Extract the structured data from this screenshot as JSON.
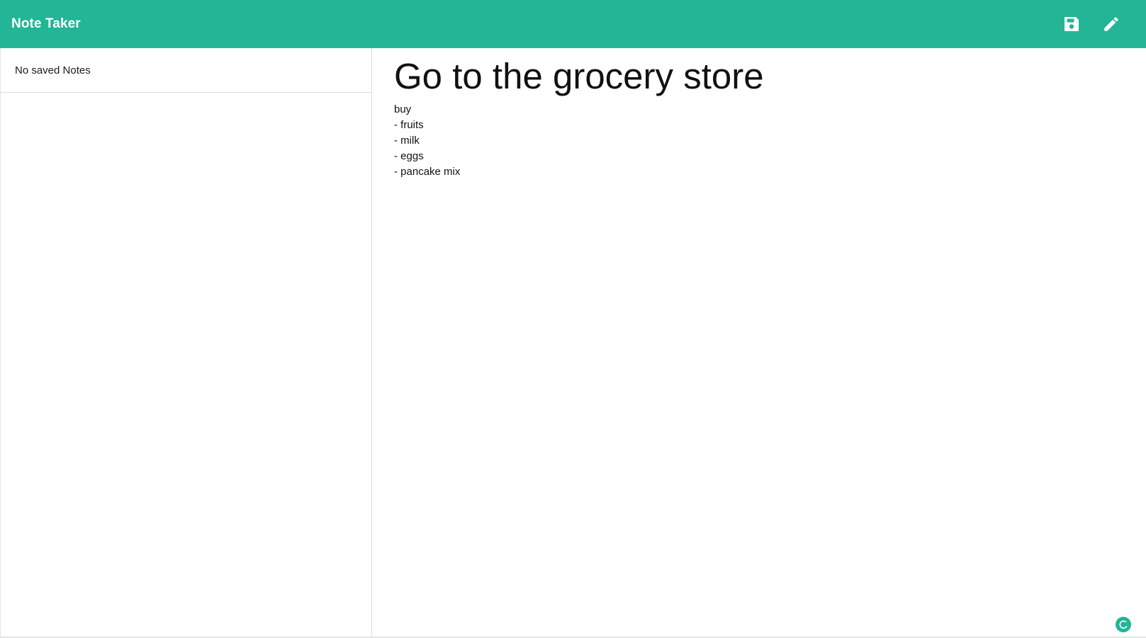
{
  "app": {
    "title": "Note Taker",
    "brand_color": "#22b596"
  },
  "toolbar": {
    "save_icon": "save-icon",
    "edit_icon": "pencil-icon"
  },
  "sidebar": {
    "empty_message": "No saved Notes"
  },
  "note": {
    "title": "Go to the grocery store",
    "body": "buy\n- fruits\n- milk\n- eggs\n- pancake mix"
  },
  "status": {
    "loader_icon": "loading-icon"
  }
}
